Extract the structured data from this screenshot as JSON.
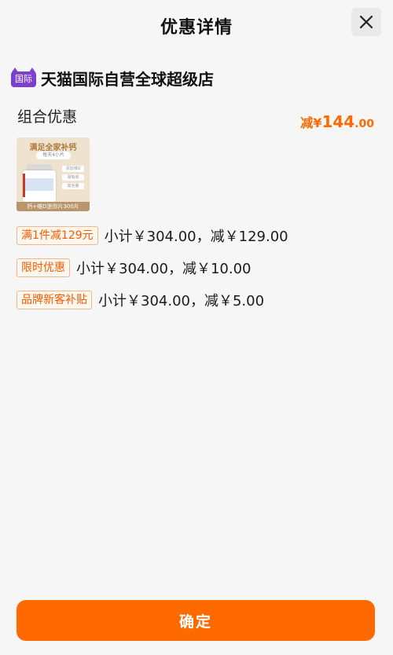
{
  "header": {
    "title": "优惠详情"
  },
  "store": {
    "logo_text": "国际",
    "name": "天猫国际自营全球超级店"
  },
  "section": {
    "title": "组合优惠",
    "total_discount": {
      "prefix": "减¥",
      "integer": "144",
      "decimal": ".00"
    }
  },
  "product": {
    "image_title": "满足全家补钙",
    "image_chip": "每天4小片",
    "image_features": [
      "添加维D",
      "易吸收",
      "高含量"
    ],
    "image_caption": "钙+维D迷你片300片"
  },
  "promotions": [
    {
      "tag": "满1件减129元",
      "detail": "小计￥304.00，减￥129.00"
    },
    {
      "tag": "限时优惠",
      "detail": "小计￥304.00，减￥10.00"
    },
    {
      "tag": "品牌新客补贴",
      "detail": "小计￥304.00，减￥5.00"
    }
  ],
  "footer": {
    "confirm_label": "确定"
  },
  "colors": {
    "accent": "#ff6a00",
    "brand_purple": "#7b3fd1",
    "tag_border": "#f0b88a"
  }
}
